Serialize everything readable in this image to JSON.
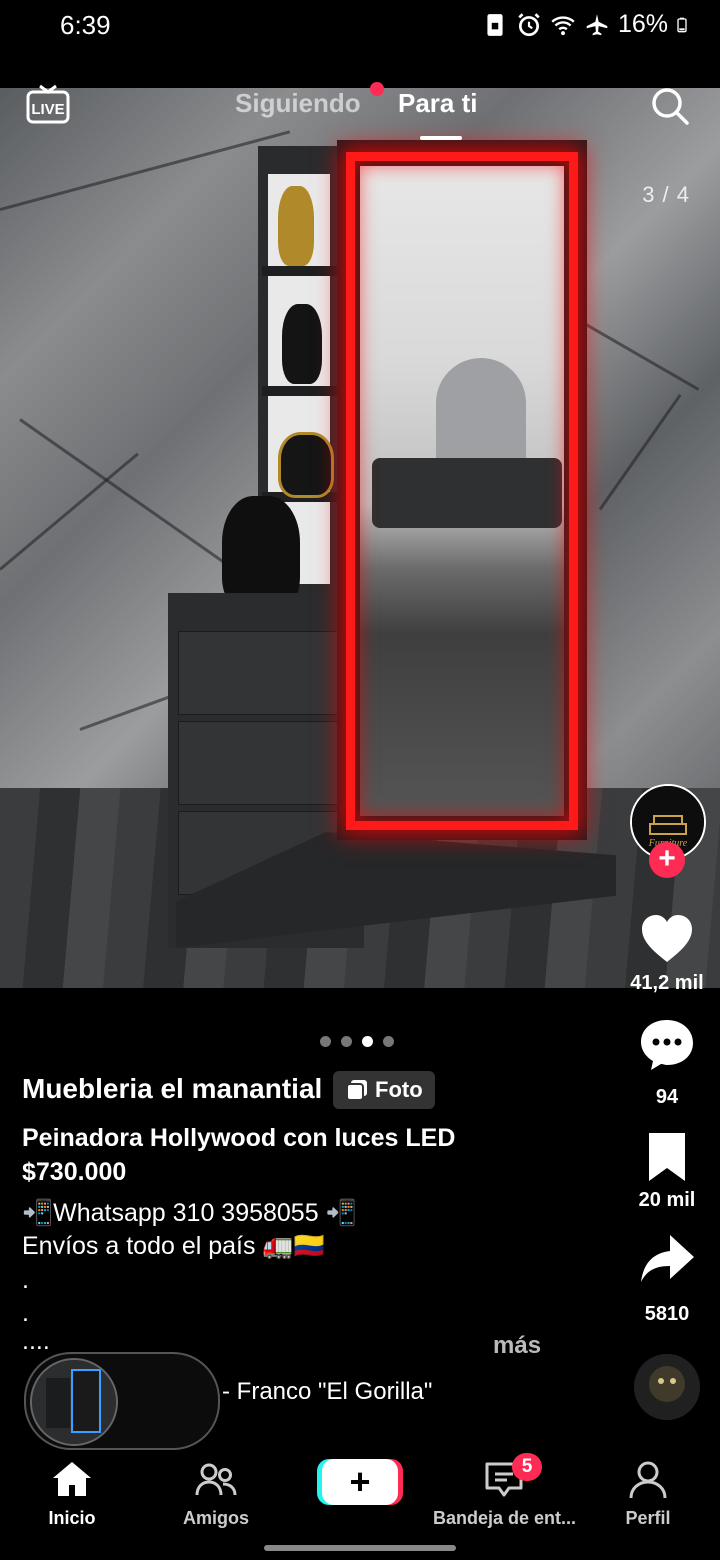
{
  "status_bar": {
    "time": "6:39",
    "battery": "16%",
    "icons": [
      "sim-icon",
      "alarm-icon",
      "wifi-icon",
      "airplane-icon",
      "battery-icon"
    ]
  },
  "top_nav": {
    "live_label": "LIVE",
    "tabs": [
      {
        "label": "Siguiendo",
        "active": false,
        "has_dot": true
      },
      {
        "label": "Para ti",
        "active": true
      }
    ]
  },
  "photo": {
    "counter": "3 / 4",
    "carousel_total": 4,
    "carousel_active": 3
  },
  "author": {
    "name": "Muebleria el manantial",
    "badge": "Foto"
  },
  "avatar": {
    "logo_text": "Furniture"
  },
  "description": {
    "title": "Peinadora Hollywood con luces LED",
    "price": "$730.000",
    "lines": [
      "📲Whatsapp 310 3958055 📲",
      "Envíos a todo el país 🚛🇨🇴",
      ".",
      ".",
      "...."
    ],
    "more": "más"
  },
  "actions": {
    "likes": "41,2 mil",
    "comments": "94",
    "saves": "20 mil",
    "shares": "5810"
  },
  "music": {
    "text": "- Franco \"El Gorilla\""
  },
  "bottom_nav": {
    "items": [
      {
        "label": "Inicio",
        "active": true
      },
      {
        "label": "Amigos",
        "active": false
      },
      {
        "label": "+",
        "active": false
      },
      {
        "label": "Bandeja de ent...",
        "active": false,
        "badge": "5"
      },
      {
        "label": "Perfil",
        "active": false
      }
    ]
  },
  "colors": {
    "accent": "#fe2c55",
    "cyan": "#25f4ee",
    "led_red": "#ff1a1a",
    "background": "#000000"
  }
}
